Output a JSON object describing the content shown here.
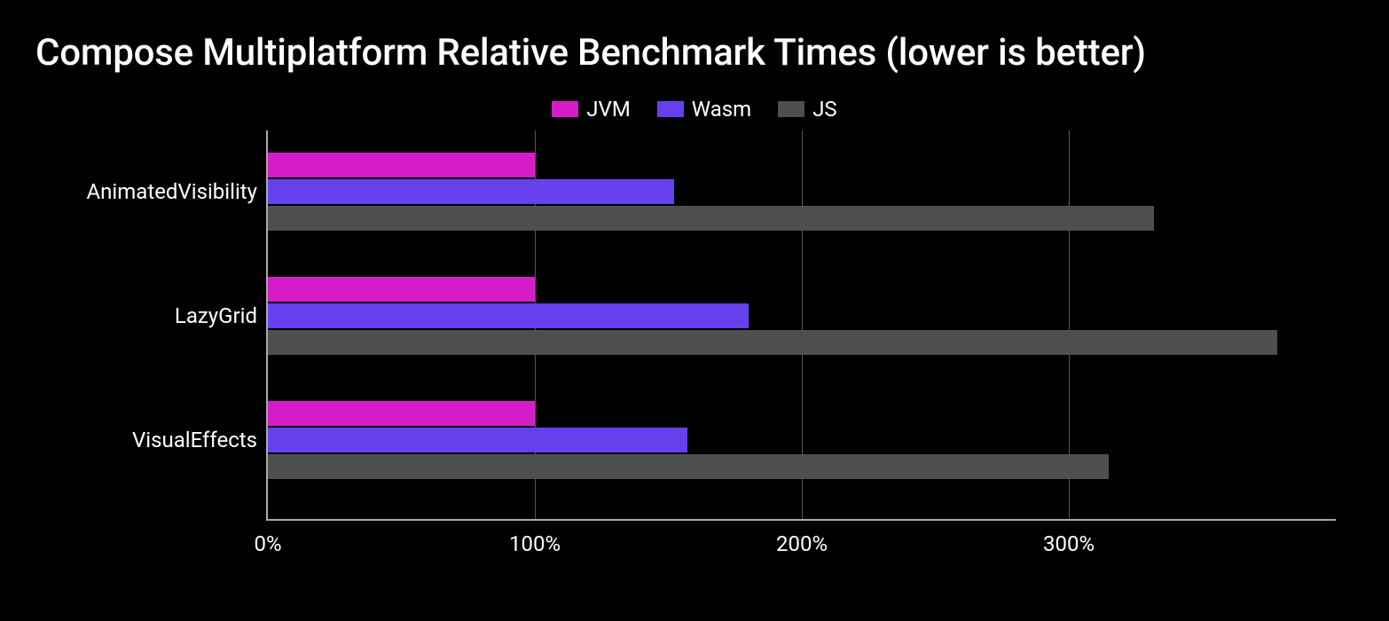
{
  "chart_data": {
    "type": "bar",
    "orientation": "horizontal",
    "title": "Compose Multiplatform Relative Benchmark Times (lower is better)",
    "xlabel": "",
    "ylabel": "",
    "x_unit": "%",
    "x_ticks": [
      0,
      100,
      200,
      300
    ],
    "xlim": [
      0,
      400
    ],
    "categories": [
      "AnimatedVisibility",
      "LazyGrid",
      "VisualEffects"
    ],
    "series": [
      {
        "name": "JVM",
        "color": "#d61cc9",
        "values": [
          100,
          100,
          100
        ]
      },
      {
        "name": "Wasm",
        "color": "#6740ee",
        "values": [
          152,
          180,
          157
        ]
      },
      {
        "name": "JS",
        "color": "#4f4f4f",
        "values": [
          332,
          378,
          315
        ]
      }
    ],
    "legend_position": "top",
    "grid": {
      "x": true,
      "y": false
    }
  }
}
